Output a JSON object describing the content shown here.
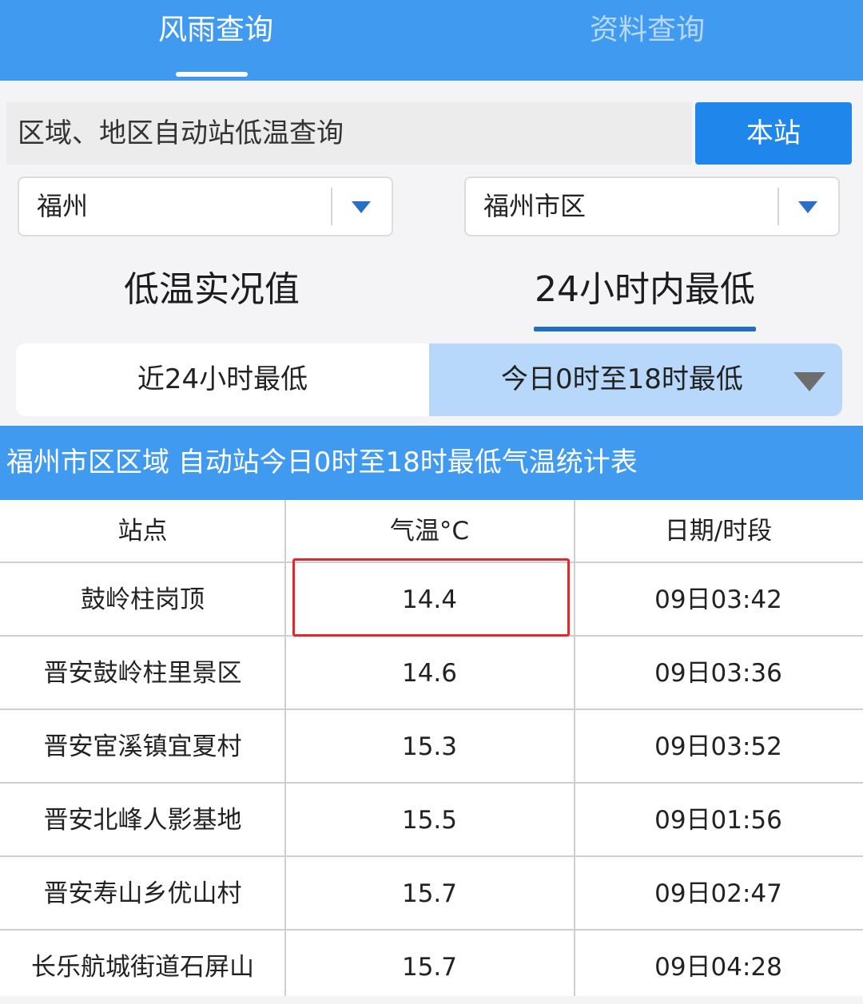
{
  "top_tabs": [
    {
      "label": "风雨查询",
      "active": true
    },
    {
      "label": "资料查询",
      "active": false
    }
  ],
  "query": {
    "label": "区域、地区自动站低温查询",
    "station_button": "本站"
  },
  "selects": {
    "city": "福州",
    "district": "福州市区"
  },
  "mode_tabs": {
    "left": "低温实况值",
    "right": "24小时内最低",
    "selected": "right"
  },
  "period": {
    "left": "近24小时最低",
    "right": "今日0时至18时最低",
    "selected": "right"
  },
  "table": {
    "title": "福州市区区域 自动站今日0时至18时最低气温统计表",
    "headers": [
      "站点",
      "气温°C",
      "日期/时段"
    ],
    "rows": [
      [
        "鼓岭柱岗顶",
        "14.4",
        "09日03:42"
      ],
      [
        "晋安鼓岭柱里景区",
        "14.6",
        "09日03:36"
      ],
      [
        "晋安宦溪镇宜夏村",
        "15.3",
        "09日03:52"
      ],
      [
        "晋安北峰人影基地",
        "15.5",
        "09日01:56"
      ],
      [
        "晋安寿山乡优山村",
        "15.7",
        "09日02:47"
      ],
      [
        "长乐航城街道石屏山",
        "15.7",
        "09日04:28"
      ]
    ]
  },
  "colors": {
    "header_blue": "#3f9af0",
    "button_blue": "#1f87ec",
    "selected_segment": "#b7d8fb",
    "highlight_red": "#e8262a"
  }
}
